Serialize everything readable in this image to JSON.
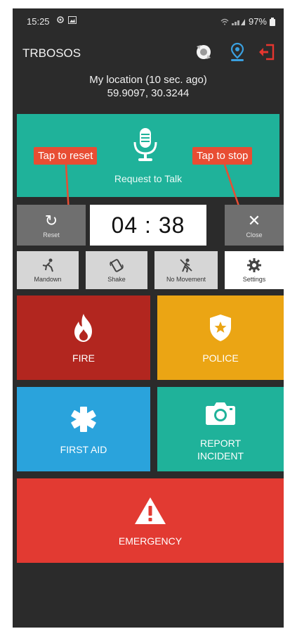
{
  "status_bar": {
    "time": "15:25",
    "signal_text": "◉ ▖▗▘",
    "battery": "97%"
  },
  "app": {
    "title": "TRBOSOS"
  },
  "location": {
    "line1": "My location (10 sec. ago)",
    "line2": "59.9097, 30.3244"
  },
  "ptt": {
    "label": "Request to Talk"
  },
  "annotations": {
    "reset": "Tap to reset",
    "stop": "Tap to stop"
  },
  "controls": {
    "reset_icon": "↻",
    "reset_label": "Reset",
    "timer": "04 : 38",
    "close_icon": "✕",
    "close_label": "Close"
  },
  "toggles": [
    {
      "label": "Mandown",
      "icon": "mandown-icon",
      "active": false
    },
    {
      "label": "Shake",
      "icon": "shake-icon",
      "active": false
    },
    {
      "label": "No Movement",
      "icon": "no-movement-icon",
      "active": false
    },
    {
      "label": "Settings",
      "icon": "gear-icon",
      "active": true
    }
  ],
  "tiles": [
    {
      "label": "FIRE",
      "icon": "flame-icon",
      "color": "#b2261f"
    },
    {
      "label": "POLICE",
      "icon": "police-badge-icon",
      "color": "#eba514"
    },
    {
      "label": "FIRST AID",
      "icon": "asterisk-icon",
      "color": "#2aa3dc"
    },
    {
      "label": "REPORT INCIDENT",
      "icon": "camera-icon",
      "color": "#1fb29a"
    },
    {
      "label": "EMERGENCY",
      "icon": "warning-icon",
      "color": "#e23a32"
    }
  ],
  "colors": {
    "background": "#2b2b2b",
    "accent_teal": "#1fb29a",
    "annotation": "#e84d33"
  }
}
